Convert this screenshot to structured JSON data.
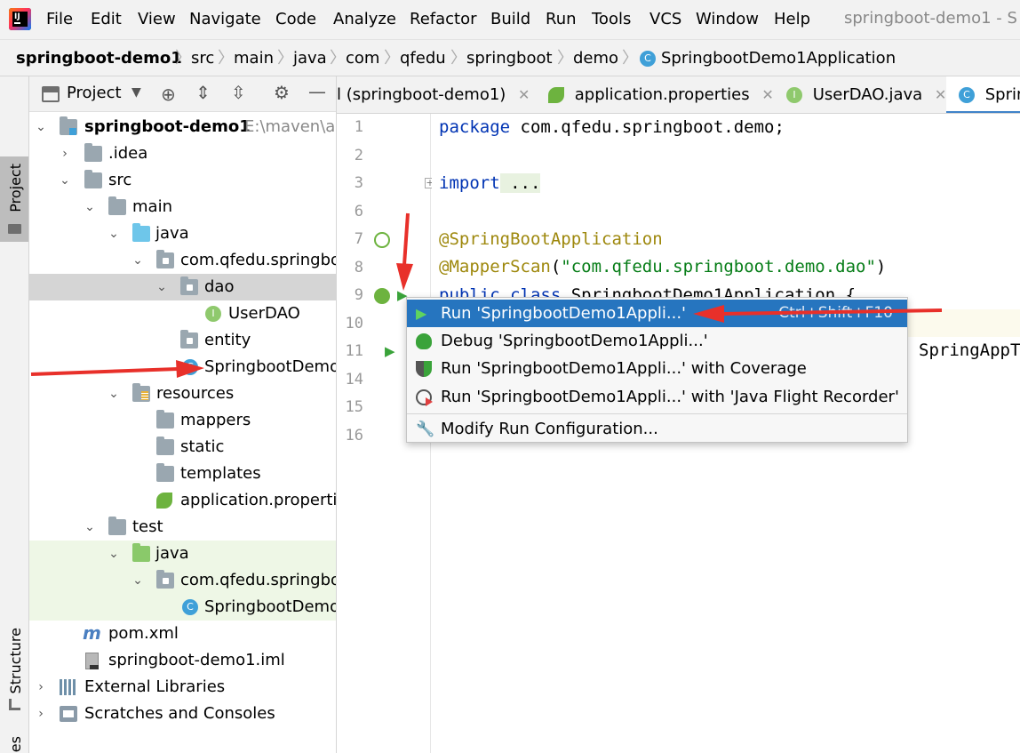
{
  "menubar": {
    "items": [
      "File",
      "Edit",
      "View",
      "Navigate",
      "Code",
      "Analyze",
      "Refactor",
      "Build",
      "Run",
      "Tools",
      "VCS",
      "Window",
      "Help"
    ],
    "window_title": "springboot-demo1 - S"
  },
  "breadcrumb": {
    "items": [
      "springboot-demo1",
      "src",
      "main",
      "java",
      "com",
      "qfedu",
      "springboot",
      "demo",
      "SpringbootDemo1Application"
    ]
  },
  "left_stripe": {
    "project": "Project",
    "structure": "Structure",
    "bottom": "es"
  },
  "project_panel": {
    "title": "Project",
    "tree": [
      {
        "label": "springboot-demo1",
        "extra": "E:\\maven\\ap"
      },
      {
        "label": ".idea"
      },
      {
        "label": "src"
      },
      {
        "label": "main"
      },
      {
        "label": "java"
      },
      {
        "label": "com.qfedu.springbo"
      },
      {
        "label": "dao"
      },
      {
        "label": "UserDAO"
      },
      {
        "label": "entity"
      },
      {
        "label": "SpringbootDemo"
      },
      {
        "label": "resources"
      },
      {
        "label": "mappers"
      },
      {
        "label": "static"
      },
      {
        "label": "templates"
      },
      {
        "label": "application.properti"
      },
      {
        "label": "test"
      },
      {
        "label": "java"
      },
      {
        "label": "com.qfedu.springbo"
      },
      {
        "label": "SpringbootDemo"
      },
      {
        "label": "pom.xml"
      },
      {
        "label": "springboot-demo1.iml"
      },
      {
        "label": "External Libraries"
      },
      {
        "label": "Scratches and Consoles"
      }
    ]
  },
  "editor_tabs": [
    {
      "label": "l (springboot-demo1)"
    },
    {
      "label": "application.properties"
    },
    {
      "label": "UserDAO.java"
    },
    {
      "label": "Sprin"
    }
  ],
  "editor": {
    "line_numbers": [
      "1",
      "2",
      "3",
      "6",
      "7",
      "8",
      "9",
      "10",
      "11",
      "14",
      "15",
      "16"
    ],
    "line1_kw": "package",
    "line1_rest": " com.qfedu.springboot.demo;",
    "line3_kw": "import",
    "line3_rest": " ...",
    "line7": "@SpringBootApplication",
    "line8_ann": "@MapperScan",
    "line8_open": "(",
    "line8_str": "\"com.qfedu.springboot.demo.dao\"",
    "line8_close": ")",
    "line9_kw": "public class",
    "line9_rest": " SpringbootDemo1Application {",
    "line11_partial": "SpringAppT"
  },
  "context_menu": {
    "items": [
      {
        "label": "Run 'SpringbootDemo1Appli...'",
        "shortcut": "Ctrl+Shift+F10",
        "icon": "run-icon"
      },
      {
        "label": "Debug 'SpringbootDemo1Appli...'",
        "icon": "debug-icon"
      },
      {
        "label": "Run 'SpringbootDemo1Appli...' with Coverage",
        "icon": "coverage-icon"
      },
      {
        "label": "Run 'SpringbootDemo1Appli...' with 'Java Flight Recorder'",
        "icon": "profiler-icon"
      },
      {
        "label": "Modify Run Configuration...",
        "icon": "wrench-icon"
      }
    ]
  },
  "colors": {
    "selection": "#2675bf",
    "annotation_arrow": "#e8302a",
    "keyword": "#0033b3",
    "string": "#067d17",
    "annotation": "#9e880d"
  }
}
